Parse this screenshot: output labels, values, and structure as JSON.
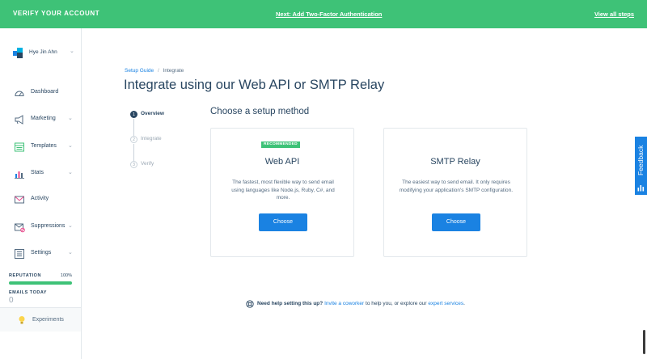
{
  "banner": {
    "title": "VERIFY YOUR ACCOUNT",
    "next_step": "Next: Add Two-Factor Authentication",
    "view_all": "View all steps"
  },
  "user": {
    "name": "Hye Jin Ahn"
  },
  "sidebar": {
    "items": [
      {
        "label": "Dashboard",
        "icon": "gauge-icon",
        "chevron": false
      },
      {
        "label": "Marketing",
        "icon": "megaphone-icon",
        "chevron": true
      },
      {
        "label": "Templates",
        "icon": "template-icon",
        "chevron": true
      },
      {
        "label": "Stats",
        "icon": "bar-chart-icon",
        "chevron": true
      },
      {
        "label": "Activity",
        "icon": "envelope-icon",
        "chevron": false
      },
      {
        "label": "Suppressions",
        "icon": "suppression-icon",
        "chevron": true
      },
      {
        "label": "Settings",
        "icon": "settings-icon",
        "chevron": true
      }
    ],
    "reputation": {
      "label": "REPUTATION",
      "value": "100%",
      "fraction": 1.0
    },
    "emails_today": {
      "label": "EMAILS TODAY",
      "value": "0"
    },
    "experiments": {
      "label": "Experiments",
      "icon": "lightbulb-icon"
    }
  },
  "breadcrumb": {
    "root": "Setup Guide",
    "separator": "/",
    "current": "Integrate"
  },
  "page_title": "Integrate using our Web API or SMTP Relay",
  "steps": [
    {
      "num": "1",
      "label": "Overview",
      "state": "active"
    },
    {
      "num": "2",
      "label": "Integrate",
      "state": "inactive"
    },
    {
      "num": "3",
      "label": "Verify",
      "state": "inactive"
    }
  ],
  "section_title": "Choose a setup method",
  "cards": {
    "web_api": {
      "badge": "RECOMMENDED",
      "title": "Web API",
      "description": "The fastest, most flexible way to send email using languages like Node.js, Ruby, C#, and more.",
      "button": "Choose"
    },
    "smtp": {
      "title": "SMTP Relay",
      "description": "The easiest way to send email. It only requires modifying your application's SMTP configuration.",
      "button": "Choose"
    }
  },
  "help": {
    "question": "Need help setting this up?",
    "invite_link": "Invite a coworker",
    "middle": " to help you, or explore our ",
    "expert_link": "expert services",
    "end": "."
  },
  "feedback": {
    "label": "Feedback"
  },
  "colors": {
    "accent": "#1a82e2",
    "brand_green": "#3ec277",
    "text": "#294661"
  }
}
